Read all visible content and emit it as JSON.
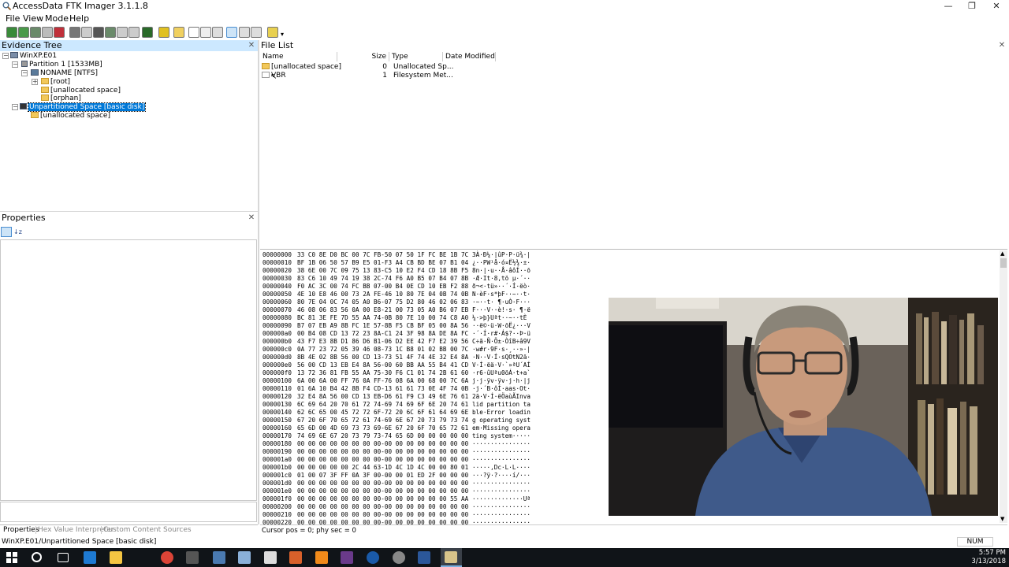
{
  "window": {
    "title": "AccessData FTK Imager 3.1.1.8",
    "minimize": "—",
    "restore": "❐",
    "close": "✕"
  },
  "menu": [
    "File",
    "View",
    "Mode",
    "Help"
  ],
  "evidence_tree": {
    "title": "Evidence Tree",
    "close": "✕",
    "nodes": [
      "WinXP.E01",
      "Partition 1 [1533MB]",
      "NONAME [NTFS]",
      "[root]",
      "[unallocated space]",
      "[orphan]",
      "Unpartitioned Space [basic disk]",
      "[unallocated space]"
    ]
  },
  "file_list": {
    "title": "File List",
    "close": "✕",
    "columns": [
      "Name",
      "Size",
      "Type",
      "Date Modified"
    ],
    "rows": [
      {
        "name": "[unallocated space]",
        "size": "0",
        "type": "Unallocated Sp...",
        "date": ""
      },
      {
        "name": "VBR",
        "size": "1",
        "type": "Filesystem Met...",
        "date": ""
      }
    ]
  },
  "properties": {
    "title": "Properties",
    "close": "✕",
    "tabs": [
      "Properties",
      "Hex Value Interpreter",
      "Custom Content Sources"
    ]
  },
  "hex": {
    "rows": [
      {
        "off": "00000000",
        "bytes": "33 C0 8E D0 BC 00 7C FB-50 07 50 1F FC BE 1B 7C",
        "ascii": "3À·Ð¼·|ûP·P·ü¾·|"
      },
      {
        "off": "00000010",
        "bytes": "BF 1B 06 50 57 B9 E5 01-F3 A4 CB BD BE 07 B1 04",
        "ascii": "¿··PW¹å·ó¤Ë½¾·±·"
      },
      {
        "off": "00000020",
        "bytes": "38 6E 00 7C 09 75 13 83-C5 10 E2 F4 CD 18 8B F5",
        "ascii": "8n·|·u··Å·âôÍ··õ"
      },
      {
        "off": "00000030",
        "bytes": "83 C6 10 49 74 19 38 2C-74 F6 A0 B5 07 B4 07 8B",
        "ascii": "·Æ·It·8,tö µ·´··"
      },
      {
        "off": "00000040",
        "bytes": "F0 AC 3C 00 74 FC BB 07-00 B4 0E CD 10 EB F2 88",
        "ascii": "ð¬<·tü»··´·Í·ëò·"
      },
      {
        "off": "00000050",
        "bytes": "4E 10 E8 46 00 73 2A FE-46 10 80 7E 04 0B 74 0B",
        "ascii": "N·èF·s*þF··~··t·"
      },
      {
        "off": "00000060",
        "bytes": "80 7E 04 0C 74 05 A0 B6-07 75 D2 80 46 02 06 83",
        "ascii": "·~··t· ¶·uÒ·F···"
      },
      {
        "off": "00000070",
        "bytes": "46 08 06 83 56 0A 00 E8-21 00 73 05 A0 B6 07 EB",
        "ascii": "F···V··è!·s· ¶·ë"
      },
      {
        "off": "00000080",
        "bytes": "BC 81 3E FE 7D 55 AA 74-0B 80 7E 10 00 74 C8 A0",
        "ascii": "¼·>þ}Uªt··~··tÈ "
      },
      {
        "off": "00000090",
        "bytes": "B7 07 EB A9 8B FC 1E 57-8B F5 CB BF 05 00 8A 56",
        "ascii": "··ë©·ü·W·õË¿···V"
      },
      {
        "off": "000000a0",
        "bytes": "00 B4 08 CD 13 72 23 8A-C1 24 3F 98 8A DE 8A FC",
        "ascii": "·´·Í·r#·Á$?··Þ·ü"
      },
      {
        "off": "000000b0",
        "bytes": "43 F7 E3 8B D1 86 D6 B1-06 D2 EE 42 F7 E2 39 56",
        "ascii": "C÷ã·Ñ·Ö±·ÒîB÷â9V"
      },
      {
        "off": "000000c0",
        "bytes": "0A 77 23 72 05 39 46 08-73 1C B8 01 02 BB 00 7C",
        "ascii": "·w#r·9F·s·¸··»·|"
      },
      {
        "off": "000000d0",
        "bytes": "8B 4E 02 8B 56 00 CD 13-73 51 4F 74 4E 32 E4 8A",
        "ascii": "·N··V·Í·sQOtN2ä·"
      },
      {
        "off": "000000e0",
        "bytes": "56 00 CD 13 EB E4 8A 56-00 60 BB AA 55 B4 41 CD",
        "ascii": "V·Í·ëä·V·`»ªU´AÍ"
      },
      {
        "off": "000000f0",
        "bytes": "13 72 36 81 FB 55 AA 75-30 F6 C1 01 74 2B 61 60",
        "ascii": "·r6·ûUªu0öÁ·t+a`"
      },
      {
        "off": "00000100",
        "bytes": "6A 00 6A 00 FF 76 0A FF-76 08 6A 00 68 00 7C 6A",
        "ascii": "j·j·ÿv·ÿv·j·h·|j"
      },
      {
        "off": "00000110",
        "bytes": "01 6A 10 B4 42 8B F4 CD-13 61 61 73 0E 4F 74 0B",
        "ascii": "·j·´B·ôÍ·aas·Ot·"
      },
      {
        "off": "00000120",
        "bytes": "32 E4 8A 56 00 CD 13 EB-D6 61 F9 C3 49 6E 76 61",
        "ascii": "2ä·V·Í·ëÖaùÃInva"
      },
      {
        "off": "00000130",
        "bytes": "6C 69 64 20 70 61 72 74-69 74 69 6F 6E 20 74 61",
        "ascii": "lid partition ta"
      },
      {
        "off": "00000140",
        "bytes": "62 6C 65 00 45 72 72 6F-72 20 6C 6F 61 64 69 6E",
        "ascii": "ble·Error loadin"
      },
      {
        "off": "00000150",
        "bytes": "67 20 6F 70 65 72 61 74-69 6E 67 20 73 79 73 74",
        "ascii": "g operating syst"
      },
      {
        "off": "00000160",
        "bytes": "65 6D 00 4D 69 73 73 69-6E 67 20 6F 70 65 72 61",
        "ascii": "em·Missing opera"
      },
      {
        "off": "00000170",
        "bytes": "74 69 6E 67 20 73 79 73-74 65 6D 00 00 00 00 00",
        "ascii": "ting system·····"
      },
      {
        "off": "00000180",
        "bytes": "00 00 00 00 00 00 00 00-00 00 00 00 00 00 00 00",
        "ascii": "················"
      },
      {
        "off": "00000190",
        "bytes": "00 00 00 00 00 00 00 00-00 00 00 00 00 00 00 00",
        "ascii": "················"
      },
      {
        "off": "000001a0",
        "bytes": "00 00 00 00 00 00 00 00-00 00 00 00 00 00 00 00",
        "ascii": "················"
      },
      {
        "off": "000001b0",
        "bytes": "00 00 00 00 00 2C 44 63-1D 4C 1D 4C 00 00 80 01",
        "ascii": "·····,Dc·L·L····"
      },
      {
        "off": "000001c0",
        "bytes": "01 00 07 3F FF 0A 3F 00-00 00 01 ED 2F 00 00 00",
        "ascii": "···?ÿ·?····í/···"
      },
      {
        "off": "000001d0",
        "bytes": "00 00 00 00 00 00 00 00-00 00 00 00 00 00 00 00",
        "ascii": "················"
      },
      {
        "off": "000001e0",
        "bytes": "00 00 00 00 00 00 00 00-00 00 00 00 00 00 00 00",
        "ascii": "················"
      },
      {
        "off": "000001f0",
        "bytes": "00 00 00 00 00 00 00 00-00 00 00 00 00 00 55 AA",
        "ascii": "··············Uª"
      },
      {
        "off": "00000200",
        "bytes": "00 00 00 00 00 00 00 00-00 00 00 00 00 00 00 00",
        "ascii": "················"
      },
      {
        "off": "00000210",
        "bytes": "00 00 00 00 00 00 00 00-00 00 00 00 00 00 00 00",
        "ascii": "················"
      },
      {
        "off": "00000220",
        "bytes": "00 00 00 00 00 00 00 00-00 00 00 00 00 00 00 00",
        "ascii": "················"
      }
    ]
  },
  "cursor_status": "Cursor pos = 0; phy sec = 0",
  "status_bar": {
    "path": "WinXP.E01/Unpartitioned Space [basic disk]",
    "num": "NUM"
  },
  "taskbar": {
    "time": "5:57 PM",
    "date": "3/13/2018"
  }
}
